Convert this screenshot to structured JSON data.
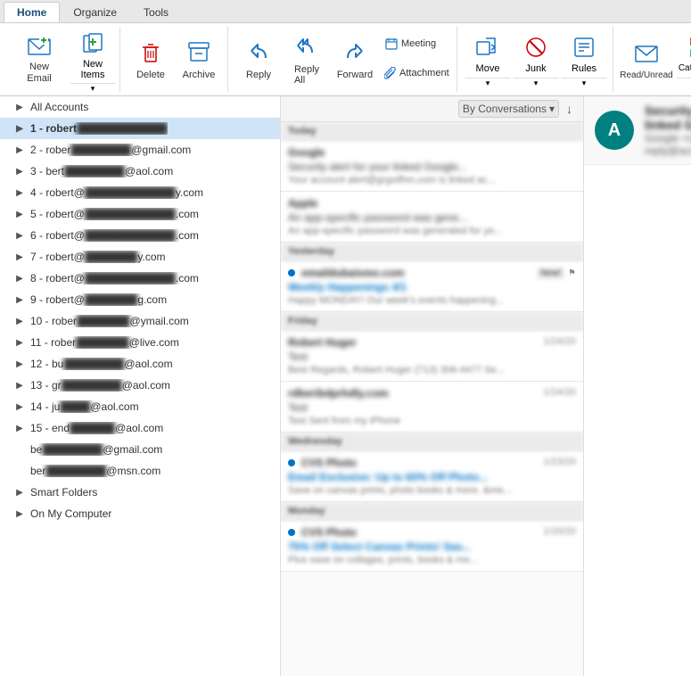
{
  "tabs": [
    {
      "id": "home",
      "label": "Home",
      "active": true
    },
    {
      "id": "organize",
      "label": "Organize",
      "active": false
    },
    {
      "id": "tools",
      "label": "Tools",
      "active": false
    }
  ],
  "ribbon": {
    "groups": [
      {
        "id": "new",
        "buttons": [
          {
            "id": "new-email",
            "label": "New\nEmail",
            "icon": "✉",
            "type": "large"
          },
          {
            "id": "new-items",
            "label": "New\nItems",
            "icon": "📋",
            "type": "split"
          }
        ]
      },
      {
        "id": "delete",
        "buttons": [
          {
            "id": "delete",
            "label": "Delete",
            "icon": "🗑",
            "type": "medium"
          },
          {
            "id": "archive",
            "label": "Archive",
            "icon": "📦",
            "type": "medium"
          }
        ]
      },
      {
        "id": "respond",
        "buttons": [
          {
            "id": "reply",
            "label": "Reply",
            "icon": "↩",
            "type": "medium"
          },
          {
            "id": "reply-all",
            "label": "Reply\nAll",
            "icon": "↩↩",
            "type": "medium"
          },
          {
            "id": "forward",
            "label": "Forward",
            "icon": "↪",
            "type": "medium"
          },
          {
            "id": "meeting",
            "label": "Meeting",
            "icon": "📅",
            "type": "small-top"
          },
          {
            "id": "attachment",
            "label": "Attachment",
            "icon": "📎",
            "type": "small-top"
          }
        ]
      },
      {
        "id": "move-group",
        "buttons": [
          {
            "id": "move",
            "label": "Move",
            "icon": "📂",
            "type": "large-split"
          },
          {
            "id": "junk",
            "label": "Junk",
            "icon": "🚫",
            "type": "large-split"
          },
          {
            "id": "rules",
            "label": "Rules",
            "icon": "⚙",
            "type": "large-split"
          }
        ]
      },
      {
        "id": "tags-group",
        "buttons": [
          {
            "id": "read-unread",
            "label": "Read/Unread",
            "icon": "📧",
            "type": "large"
          },
          {
            "id": "categorize",
            "label": "Categorize",
            "icon": "🏷",
            "type": "large-split"
          }
        ]
      }
    ]
  },
  "sidebar": {
    "items": [
      {
        "id": "all-accounts",
        "label": "All Accounts",
        "level": 0,
        "hasChevron": true,
        "active": false
      },
      {
        "id": "account-1",
        "label": "1 - robert",
        "blurSuffix": true,
        "level": 0,
        "hasChevron": true,
        "active": true
      },
      {
        "id": "account-2",
        "label": "2 - rober",
        "blurSuffix": true,
        "suffix": "@gmail.com",
        "level": 0,
        "hasChevron": true
      },
      {
        "id": "account-3",
        "label": "3 - bert",
        "blurSuffix": true,
        "suffix": "@aol.com",
        "level": 0,
        "hasChevron": true
      },
      {
        "id": "account-4",
        "label": "4 - robert@",
        "blurSuffix": true,
        "suffix": "y.com",
        "level": 0,
        "hasChevron": true
      },
      {
        "id": "account-5",
        "label": "5 - robert@",
        "blurSuffix": true,
        "suffix": ".com",
        "level": 0,
        "hasChevron": true
      },
      {
        "id": "account-6",
        "label": "6 - robert@",
        "blurSuffix": true,
        "suffix": ".com",
        "level": 0,
        "hasChevron": true
      },
      {
        "id": "account-7",
        "label": "7 - robert@",
        "blurSuffix": true,
        "suffix": "y.com",
        "level": 0,
        "hasChevron": true
      },
      {
        "id": "account-8",
        "label": "8 - robert@",
        "blurSuffix": true,
        "suffix": ".com",
        "level": 0,
        "hasChevron": true
      },
      {
        "id": "account-9",
        "label": "9 - robert@",
        "blurSuffix": true,
        "suffix": "g.com",
        "level": 0,
        "hasChevron": true
      },
      {
        "id": "account-10",
        "label": "10 - rober",
        "blurSuffix": true,
        "suffix": "@ymail.com",
        "level": 0,
        "hasChevron": true
      },
      {
        "id": "account-11",
        "label": "11 - rober",
        "blurSuffix": true,
        "suffix": "@live.com",
        "level": 0,
        "hasChevron": true
      },
      {
        "id": "account-12",
        "label": "12 - bu",
        "blurSuffix": true,
        "suffix": "@aol.com",
        "level": 0,
        "hasChevron": true
      },
      {
        "id": "account-13",
        "label": "13 - gr",
        "blurSuffix": true,
        "suffix": "@aol.com",
        "level": 0,
        "hasChevron": true
      },
      {
        "id": "account-14",
        "label": "14 - ju",
        "blurSuffix": true,
        "suffix": "@aol.com",
        "level": 0,
        "hasChevron": true
      },
      {
        "id": "account-15",
        "label": "15 - end",
        "blurSuffix": true,
        "suffix": "@aol.com",
        "level": 0,
        "hasChevron": true
      },
      {
        "id": "account-be",
        "label": "be",
        "blurSuffix": true,
        "suffix": "@gmail.com",
        "level": 0,
        "hasChevron": false
      },
      {
        "id": "account-ber",
        "label": "ber",
        "blurSuffix": true,
        "suffix": "@msn.com",
        "level": 0,
        "hasChevron": false
      },
      {
        "id": "smart-folders",
        "label": "Smart Folders",
        "level": 0,
        "hasChevron": true
      },
      {
        "id": "on-my-computer",
        "label": "On My Computer",
        "level": 0,
        "hasChevron": true
      }
    ]
  },
  "email_list": {
    "conversations_label": "By Conversations",
    "sections": [
      {
        "id": "today",
        "label": "Today",
        "emails": [
          {
            "id": "email-1",
            "sender": "Google",
            "time": "",
            "subject": "Security alert for your linked Google...",
            "preview": "Your account alert@grgoifhm.com is linked ac...",
            "unread": false,
            "dot": false
          },
          {
            "id": "email-2",
            "sender": "Apple",
            "time": "",
            "subject": "An app-specific password was gene...",
            "preview": "An app-specific password was generated for yo...",
            "unread": false,
            "dot": false
          }
        ]
      },
      {
        "id": "yesterday",
        "label": "Yesterday",
        "emails": [
          {
            "id": "email-3",
            "sender": "emaildubaismo.com",
            "time": "",
            "subject": "Weekly Happenings 4/1",
            "preview": "Happy MONDAY! Our week's events happening...",
            "unread": true,
            "dot": true,
            "badge": "New!"
          }
        ]
      },
      {
        "id": "friday",
        "label": "Friday",
        "emails": [
          {
            "id": "email-4",
            "sender": "Robert Huger",
            "time": "1/24/20",
            "subject": "Test",
            "preview": "Best Regards, Robert Huger (713) 306-4477 Se...",
            "unread": false,
            "dot": false
          },
          {
            "id": "email-5",
            "sender": "rdberibdprhdly.com",
            "time": "1/24/20",
            "subject": "Test",
            "preview": "Test Sent from my iPhone",
            "unread": false,
            "dot": false
          }
        ]
      },
      {
        "id": "wednesday",
        "label": "Wednesday",
        "emails": [
          {
            "id": "email-6",
            "sender": "CVS Photo",
            "time": "1/23/20",
            "subject": "Email Exclusive: Up to 60% Off Photo...",
            "preview": "Save on canvas prints, photo books & more. &me...",
            "unread": true,
            "dot": true
          }
        ]
      },
      {
        "id": "monday",
        "label": "Monday",
        "emails": [
          {
            "id": "email-7",
            "sender": "CVS Photo",
            "time": "1/20/20",
            "subject": "75% Off Select Canvas Prints! Sav...",
            "preview": "Plus save on collages, prints, books & mo...",
            "unread": true,
            "dot": true
          }
        ]
      }
    ]
  },
  "reading_pane": {
    "avatar_letter": "A",
    "subject": "Security alert for your linked Google Account",
    "from": "Google <no-reply@accounts.google.com>"
  },
  "colors": {
    "accent": "#0072c6",
    "active_tab_bg": "#ffffff",
    "ribbon_bg": "#ffffff",
    "avatar_bg": "#008080"
  }
}
